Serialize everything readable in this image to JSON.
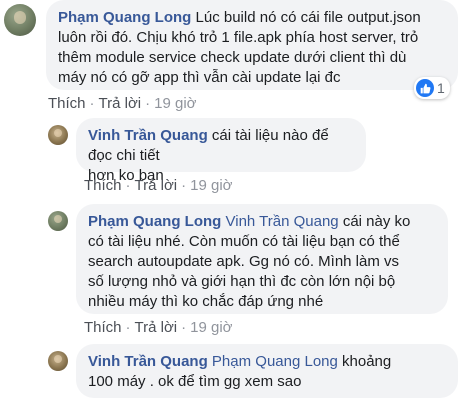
{
  "comments": [
    {
      "author": "Phạm Quang Long",
      "text": " Lúc build nó có cái file output.json\nluôn rồi đó. Chịu khó trỏ 1 file.apk phía host server, trỏ\nthêm module service check update dưới client thì dù\nmáy nó có gỡ app thì vẫn cài update lại đc",
      "like_label": "Thích",
      "reply_label": "Trả lời",
      "time": "19 giờ",
      "reaction_count": "1"
    },
    {
      "author": "Vinh Trần Quang",
      "text": " cái tài liệu nào để đọc chi tiết\nhơn ko bạn",
      "like_label": "Thích",
      "reply_label": "Trả lời",
      "time": "19 giờ"
    },
    {
      "author": "Phạm Quang Long",
      "mention": "Vinh Trần Quang",
      "text": " cái này ko\ncó tài liệu nhé. Còn muốn có tài liệu bạn có thể\nsearch autoupdate apk. Gg nó có. Mình làm vs\nsố lượng nhỏ và giới hạn thì đc còn lớn nội bộ\nnhiều máy thì ko chắc đáp ứng nhé",
      "like_label": "Thích",
      "reply_label": "Trả lời",
      "time": "19 giờ"
    },
    {
      "author": "Vinh Trần Quang",
      "mention": "Phạm Quang Long",
      "text": " khoảng\n100 máy . ok để tìm gg xem sao"
    }
  ],
  "separator": "·",
  "colors": {
    "link": "#385898",
    "bubble": "#f2f3f5",
    "like_blue": "#2078f4"
  },
  "icons": {
    "reaction": "like-thumbs-up-icon"
  }
}
